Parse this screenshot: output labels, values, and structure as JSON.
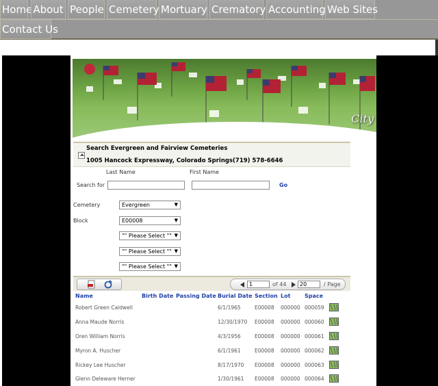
{
  "nav": {
    "items": [
      "Home",
      "About",
      "People",
      "Cemetery",
      "Mortuary",
      "Crematory",
      "Accounting",
      "Web Sites",
      "Contact Us"
    ]
  },
  "banner": {
    "caption": "City"
  },
  "header": {
    "title": "Search Evergreen and Fairview Cemeteries",
    "address": "1005 Hancock Expressway, Colorado Springs(719) 578-6646"
  },
  "search": {
    "last_name_label": "Last Name",
    "first_name_label": "First Name",
    "search_for_label": "Search for",
    "last_name_value": "",
    "first_name_value": "",
    "go_label": "Go",
    "cemetery_label": "Cemetery",
    "cemetery_value": "Evergreen",
    "block_label": "Block",
    "block_value": "E00008",
    "select1": "\"\" Please Select \"\"",
    "select2": "\"\" Please Select \"\"",
    "select3": "\"\" Please Select \"\""
  },
  "pager": {
    "page": "1",
    "of_label": "of 44",
    "page_size": "20",
    "per_page_label": "/ Page"
  },
  "table": {
    "columns": [
      "Name",
      "Birth Date",
      "Passing Date",
      "Burial Date",
      "Section",
      "Lot",
      "Space"
    ],
    "rows": [
      {
        "name": "Robert Green Caldwell",
        "birth": "",
        "passing": "",
        "burial": "6/1/1965",
        "section": "E00008",
        "lot": "000000",
        "space": "000059"
      },
      {
        "name": "Anna Maude Norris",
        "birth": "",
        "passing": "",
        "burial": "12/30/1970",
        "section": "E00008",
        "lot": "000000",
        "space": "000060"
      },
      {
        "name": "Oren William Norris",
        "birth": "",
        "passing": "",
        "burial": "4/3/1956",
        "section": "E00008",
        "lot": "000000",
        "space": "000061"
      },
      {
        "name": "Myron A. Huscher",
        "birth": "",
        "passing": "",
        "burial": "6/1/1961",
        "section": "E00008",
        "lot": "000000",
        "space": "000062"
      },
      {
        "name": "Rickey Lee Huscher",
        "birth": "",
        "passing": "",
        "burial": "8/17/1970",
        "section": "E00008",
        "lot": "000000",
        "space": "000063"
      },
      {
        "name": "Glenn Deleware Herner",
        "birth": "",
        "passing": "",
        "burial": "1/30/1961",
        "section": "E00008",
        "lot": "000000",
        "space": "000064"
      }
    ]
  },
  "colors": {
    "nav_bg": "#979797",
    "link_blue": "#1f3fa6",
    "header_bg": "#f3f3ee"
  }
}
